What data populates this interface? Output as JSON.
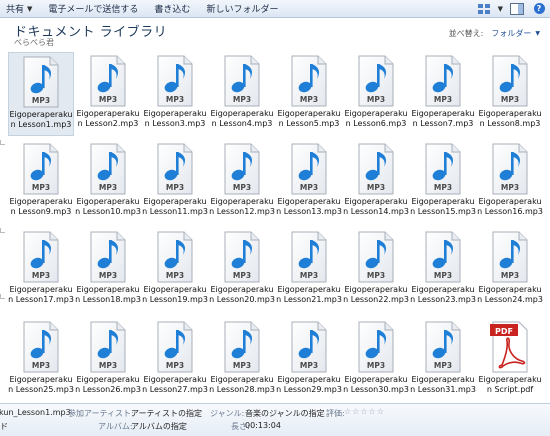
{
  "toolbar": {
    "share_label": "共有",
    "email_label": "電子メールで送信する",
    "burn_label": "書き込む",
    "new_folder_label": "新しいフォルダー"
  },
  "library": {
    "title": "ドキュメント ライブラリ",
    "subtitle": "べらべら君",
    "arrange_label": "並べ替え:",
    "arrange_value": "フォルダー"
  },
  "files": [
    {
      "name": "Eigoperaperakun Lesson1.mp3",
      "type": "mp3"
    },
    {
      "name": "Eigoperaperakun Lesson2.mp3",
      "type": "mp3"
    },
    {
      "name": "Eigoperaperakun Lesson3.mp3",
      "type": "mp3"
    },
    {
      "name": "Eigoperaperakun Lesson4.mp3",
      "type": "mp3"
    },
    {
      "name": "Eigoperaperakun Lesson5.mp3",
      "type": "mp3"
    },
    {
      "name": "Eigoperaperakun Lesson6.mp3",
      "type": "mp3"
    },
    {
      "name": "Eigoperaperakun Lesson7.mp3",
      "type": "mp3"
    },
    {
      "name": "Eigoperaperakun Lesson8.mp3",
      "type": "mp3"
    },
    {
      "name": "Eigoperaperakun Lesson9.mp3",
      "type": "mp3"
    },
    {
      "name": "Eigoperaperakun Lesson10.mp3",
      "type": "mp3"
    },
    {
      "name": "Eigoperaperakun Lesson11.mp3",
      "type": "mp3"
    },
    {
      "name": "Eigoperaperakun Lesson12.mp3",
      "type": "mp3"
    },
    {
      "name": "Eigoperaperakun Lesson13.mp3",
      "type": "mp3"
    },
    {
      "name": "Eigoperaperakun Lesson14.mp3",
      "type": "mp3"
    },
    {
      "name": "Eigoperaperakun Lesson15.mp3",
      "type": "mp3"
    },
    {
      "name": "Eigoperaperakun Lesson16.mp3",
      "type": "mp3"
    },
    {
      "name": "Eigoperaperakun Lesson17.mp3",
      "type": "mp3"
    },
    {
      "name": "Eigoperaperakun Lesson18.mp3",
      "type": "mp3"
    },
    {
      "name": "Eigoperaperakun Lesson19.mp3",
      "type": "mp3"
    },
    {
      "name": "Eigoperaperakun Lesson20.mp3",
      "type": "mp3"
    },
    {
      "name": "Eigoperaperakun Lesson21.mp3",
      "type": "mp3"
    },
    {
      "name": "Eigoperaperakun Lesson22.mp3",
      "type": "mp3"
    },
    {
      "name": "Eigoperaperakun Lesson23.mp3",
      "type": "mp3"
    },
    {
      "name": "Eigoperaperakun Lesson24.mp3",
      "type": "mp3"
    },
    {
      "name": "Eigoperaperakun Lesson25.mp3",
      "type": "mp3"
    },
    {
      "name": "Eigoperaperakun Lesson26.mp3",
      "type": "mp3"
    },
    {
      "name": "Eigoperaperakun Lesson27.mp3",
      "type": "mp3"
    },
    {
      "name": "Eigoperaperakun Lesson28.mp3",
      "type": "mp3"
    },
    {
      "name": "Eigoperaperakun Lesson29.mp3",
      "type": "mp3"
    },
    {
      "name": "Eigoperaperakun Lesson30.mp3",
      "type": "mp3"
    },
    {
      "name": "Eigoperaperakun Lesson31.mp3",
      "type": "mp3"
    },
    {
      "name": "Eigoperaperakun Script.pdf",
      "type": "pdf"
    }
  ],
  "selected_index": 0,
  "icon_text": {
    "mp3": "MP3",
    "pdf": "PDF"
  },
  "details": {
    "filename": "kun_Lesson1.mp3",
    "type_fragment": "ド",
    "artist_label": "参加アーティスト:",
    "artist_value": "アーティストの指定",
    "album_label": "アルバム:",
    "album_value": "アルバムの指定",
    "genre_label": "ジャンル:",
    "genre_value": "音楽のジャンルの指定",
    "length_label": "長さ:",
    "length_value": "00:13:04",
    "rating_label": "評価:",
    "rating_stars": "☆☆☆☆☆"
  },
  "colors": {
    "note_blue": "#1f7fd6",
    "pdf_red": "#c8231e",
    "title_blue": "#1e395b"
  }
}
